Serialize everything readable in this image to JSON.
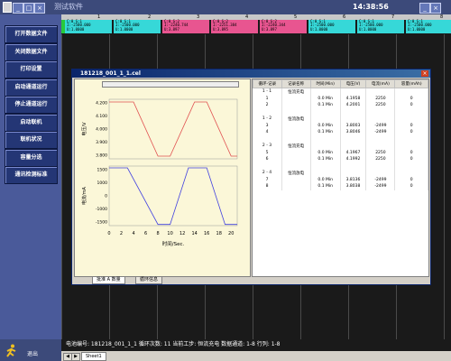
{
  "app": {
    "title": "测试软件",
    "clock": "14:38:56"
  },
  "window_controls": [
    "_",
    "□",
    "×"
  ],
  "sidebar": {
    "buttons": [
      "打开数据文件",
      "关闭数据文件",
      "打印设置",
      "启动通道运行",
      "停止通道运行",
      "启动联机",
      "联机状况",
      "容量分选",
      "通讯检测标准"
    ],
    "exit_label": "退出"
  },
  "channel_ruler": [
    "1",
    "2",
    "3",
    "4",
    "5",
    "6",
    "7",
    "8"
  ],
  "channels": [
    {
      "l1": "C:0 S:1",
      "l2": "I:-2500.000",
      "l3": "U:1.0000",
      "color": "cy"
    },
    {
      "l1": "C:0 S:1",
      "l2": "I:-2500.000",
      "l3": "U:1.0000",
      "color": "cy"
    },
    {
      "l1": "C:0 S:2",
      "l2": "I:-2240.744",
      "l3": "U:3.897",
      "color": "mg"
    },
    {
      "l1": "C:0 S:2",
      "l2": "I:-2251.384",
      "l3": "U:3.895",
      "color": "mg"
    },
    {
      "l1": "C:0 S:2",
      "l2": "I:-2240.344",
      "l3": "U:3.897",
      "color": "mg"
    },
    {
      "l1": "C:0 S:1",
      "l2": "I:-2500.000",
      "l3": "U:1.0000",
      "color": "cy"
    },
    {
      "l1": "C:0 S:1",
      "l2": "I:-2500.000",
      "l3": "U:1.0000",
      "color": "cy"
    },
    {
      "l1": "C:0 S:1",
      "l2": "I:-2500.000",
      "l3": "U:1.0000",
      "color": "cy"
    }
  ],
  "dialog": {
    "title": "181218_001_1_1.cel",
    "close_glyph": "×",
    "table": {
      "headers": [
        "循环-记录",
        "记录名称",
        "时间(Min)",
        "电压(V)",
        "电流(mA)",
        "容量(mAh)"
      ],
      "rows": [
        [
          "1 - 1",
          "恒流充电",
          "",
          "",
          "",
          ""
        ],
        [
          "1",
          "",
          "0.0 Min",
          "4.1958",
          "2250",
          "0"
        ],
        [
          "2",
          "",
          "0.1 Min",
          "4.2001",
          "2250",
          "0"
        ],
        [
          "",
          "",
          "",
          "",
          "",
          ""
        ],
        [
          "1 - 2",
          "恒流放电",
          "",
          "",
          "",
          ""
        ],
        [
          "3",
          "",
          "0.0 Min",
          "3.8003",
          "-2499",
          "0"
        ],
        [
          "4",
          "",
          "0.1 Min",
          "3.8046",
          "-2499",
          "0"
        ],
        [
          "",
          "",
          "",
          "",
          "",
          ""
        ],
        [
          "2 - 3",
          "恒流充电",
          "",
          "",
          "",
          ""
        ],
        [
          "5",
          "",
          "0.0 Min",
          "4.1967",
          "2250",
          "0"
        ],
        [
          "6",
          "",
          "0.1 Min",
          "4.1992",
          "2250",
          "0"
        ],
        [
          "",
          "",
          "",
          "",
          "",
          ""
        ],
        [
          "2 - 4",
          "恒流放电",
          "",
          "",
          "",
          ""
        ],
        [
          "7",
          "",
          "0.0 Min",
          "3.8136",
          "-2499",
          "0"
        ],
        [
          "8",
          "",
          "0.1 Min",
          "3.8038",
          "-2499",
          "0"
        ]
      ]
    },
    "tabs": [
      "批准 A 数量",
      "循环信息"
    ]
  },
  "chart_data": {
    "type": "line",
    "x": [
      0,
      2,
      4,
      6,
      8,
      10,
      12,
      14,
      16,
      18,
      20
    ],
    "xlabel": "时间/Sec.",
    "xticks": [
      "0",
      "2",
      "4",
      "6",
      "8",
      "10",
      "12",
      "14",
      "16",
      "18",
      "20"
    ],
    "panels": [
      {
        "ylabel": "电压/V",
        "yticks": [
          "4.200",
          "4.100",
          "4.000",
          "3.900",
          "3.800"
        ],
        "ylim": [
          3.78,
          4.22
        ],
        "series": [
          {
            "color": "#e05050",
            "points": [
              [
                0,
                4.2
              ],
              [
                4,
                4.2
              ],
              [
                8,
                3.8
              ],
              [
                10,
                3.8
              ],
              [
                14,
                4.2
              ],
              [
                16,
                4.2
              ],
              [
                20,
                3.8
              ],
              [
                21,
                3.8
              ]
            ]
          }
        ]
      },
      {
        "ylabel": "电流/mA",
        "yticks": [
          "1500",
          "1000",
          "0",
          "-1000",
          "-1500"
        ],
        "ylim": [
          -2600,
          2400
        ],
        "series": [
          {
            "color": "#4040e0",
            "points": [
              [
                0,
                2250
              ],
              [
                3,
                2250
              ],
              [
                8,
                -2500
              ],
              [
                10,
                -2500
              ],
              [
                13,
                2250
              ],
              [
                16,
                2250
              ],
              [
                19,
                -2500
              ],
              [
                21,
                -2500
              ]
            ]
          }
        ]
      }
    ]
  },
  "status_bar": "电池编号: 181218_001_1_1 循环次数: 11 当前工步: 恒流充电 数据通道: 1-8 行列: 1-8",
  "sheet_tab": "Sheet1"
}
